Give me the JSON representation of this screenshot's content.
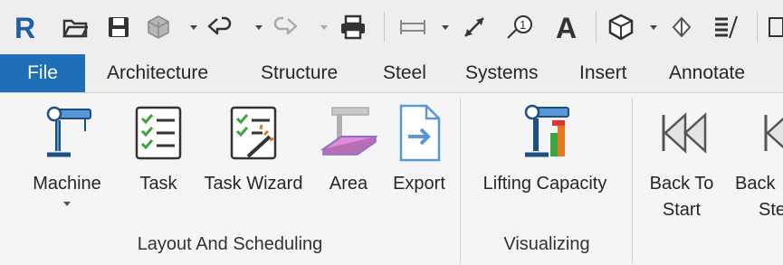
{
  "quick_access": {
    "icons": [
      "revit-logo-icon",
      "open-folder-icon",
      "save-icon",
      "sync-icon",
      "undo-icon",
      "redo-icon",
      "print-icon",
      "measure-icon",
      "aligned-dimension-icon",
      "tag-icon",
      "text-icon",
      "3d-view-icon",
      "section-icon",
      "thin-lines-icon",
      "switch-windows-icon"
    ]
  },
  "tabs": [
    "File",
    "Architecture",
    "Structure",
    "Steel",
    "Systems",
    "Insert",
    "Annotate"
  ],
  "ribbon": {
    "buttons": {
      "machine": "Machine",
      "task": "Task",
      "task_wizard": "Task Wizard",
      "area": "Area",
      "export": "Export",
      "lifting_capacity": "Lifting Capacity",
      "back_to_start_1": "Back To",
      "back_to_start_2": "Start",
      "back_step_1": "Back",
      "back_step_2": "Step"
    },
    "groups": {
      "layout": "Layout And Scheduling",
      "visualizing": "Visualizing"
    }
  },
  "colors": {
    "file_tab": "#1f6fb8",
    "crane_blue": "#2f6fb2",
    "capacity_green": "#3aa53a",
    "capacity_orange": "#e8761e",
    "area_pink": "#e28bd8"
  }
}
